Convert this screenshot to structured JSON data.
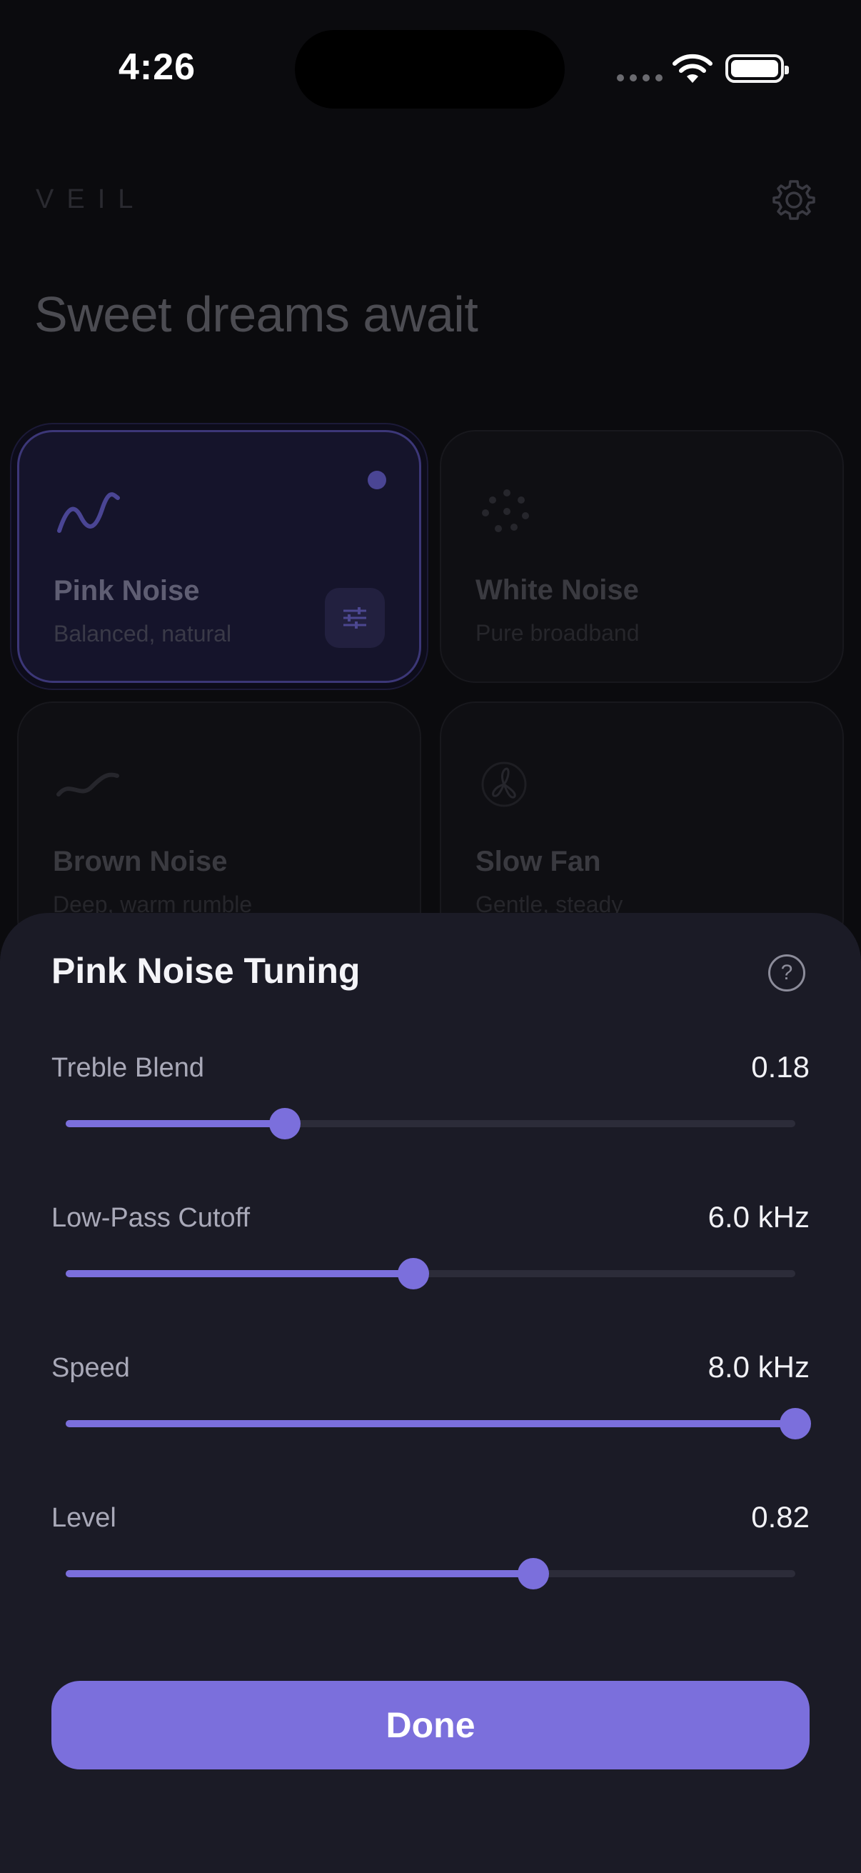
{
  "status": {
    "time": "4:26"
  },
  "header": {
    "brand": "VEIL",
    "greeting": "Sweet dreams await"
  },
  "cards": [
    {
      "title": "Pink Noise",
      "subtitle": "Balanced, natural",
      "icon": "wave-icon",
      "active": true
    },
    {
      "title": "White Noise",
      "subtitle": "Pure broadband",
      "icon": "dots-icon"
    },
    {
      "title": "Brown Noise",
      "subtitle": "Deep, warm rumble",
      "icon": "low-wave-icon"
    },
    {
      "title": "Slow Fan",
      "subtitle": "Gentle, steady",
      "icon": "fan-icon"
    }
  ],
  "sheet": {
    "title": "Pink Noise Tuning",
    "help_glyph": "?",
    "sliders": [
      {
        "label": "Treble Blend",
        "value": "0.18",
        "level": 0.3
      },
      {
        "label": "Low-Pass Cutoff",
        "value": "6.0 kHz",
        "level": 0.477
      },
      {
        "label": "Speed",
        "value": "8.0 kHz",
        "level": 1.0
      },
      {
        "label": "Level",
        "value": "0.82",
        "level": 0.641
      }
    ],
    "done_label": "Done"
  },
  "colors": {
    "accent": "#7b6fdc",
    "sheet": "#1b1b26",
    "background": "#0b0b0e"
  }
}
